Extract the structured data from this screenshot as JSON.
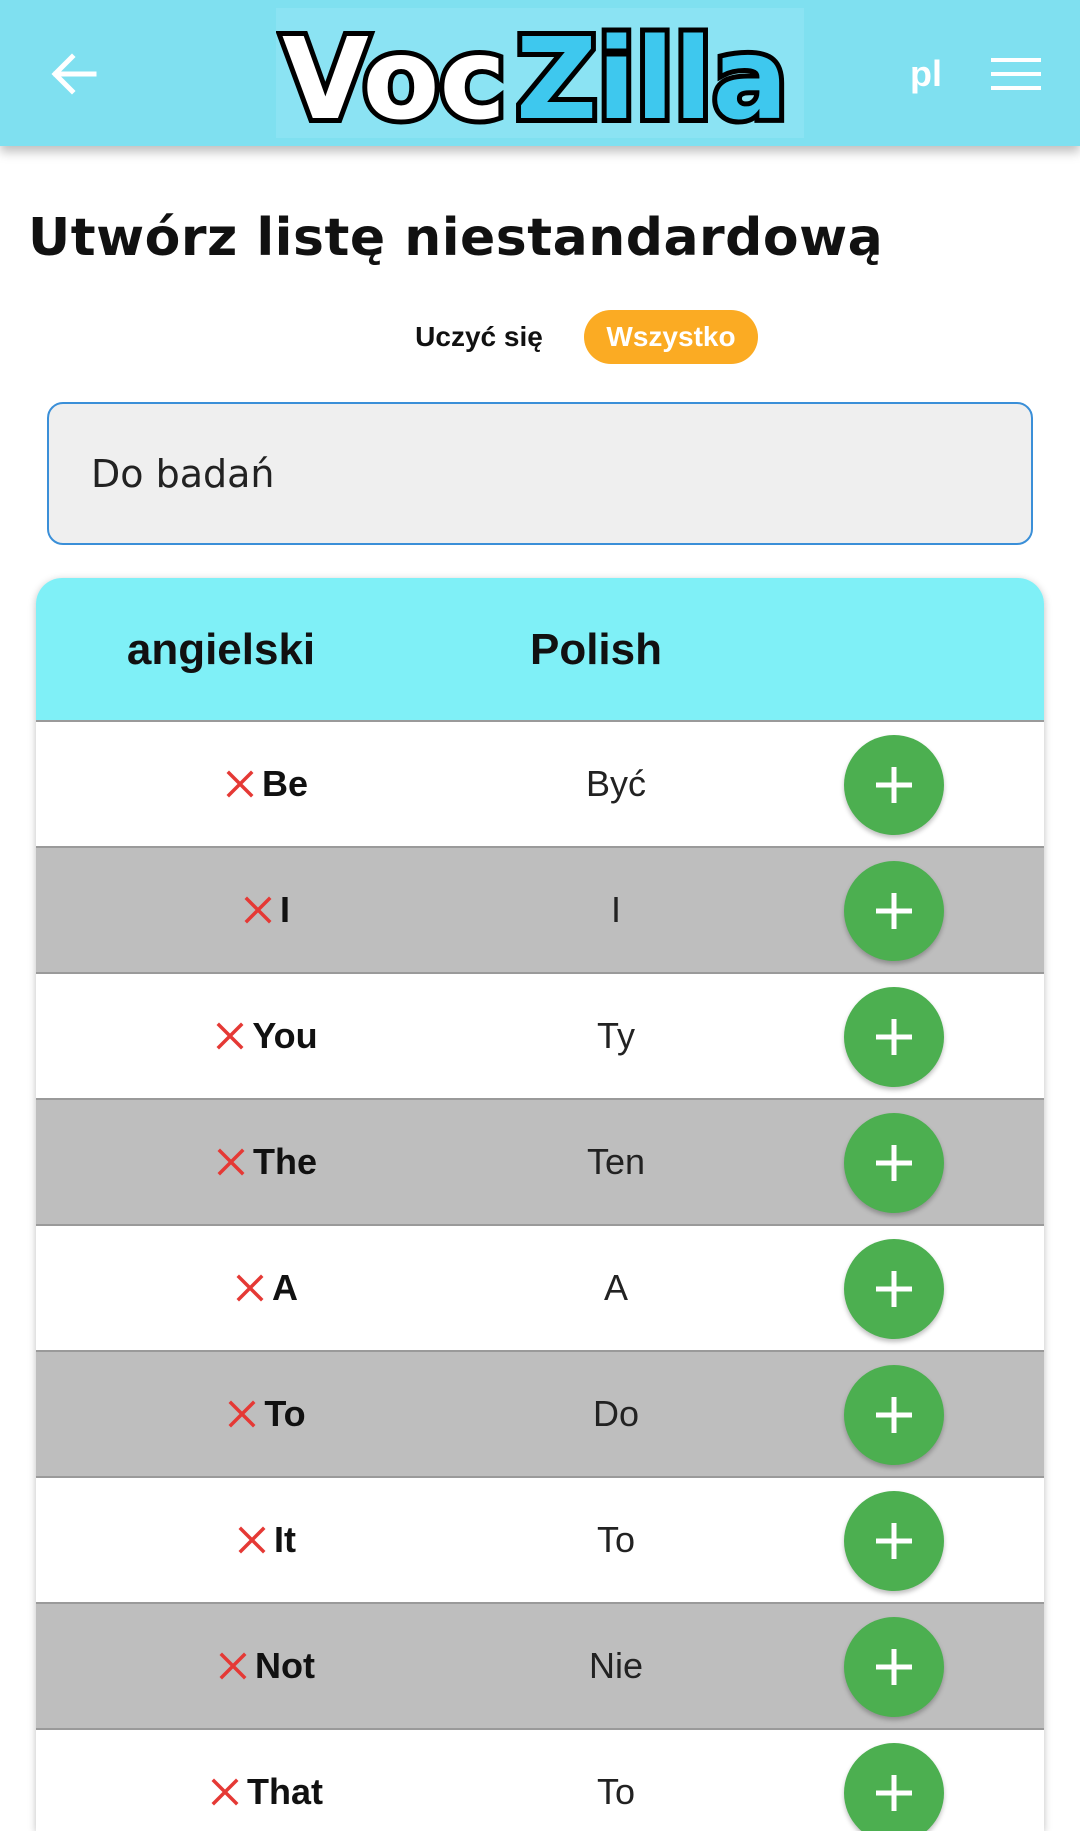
{
  "header": {
    "logo_text_a": "Voc",
    "logo_text_b": "Zilla",
    "language": "pl"
  },
  "page": {
    "title": "Utwórz listę niestandardową"
  },
  "toggle": {
    "learn_label": "Uczyć się",
    "all_label": "Wszystko"
  },
  "list_name": {
    "value": "Do badań"
  },
  "table": {
    "col_source": "angielski",
    "col_target": "Polish",
    "rows": [
      {
        "en": "Be",
        "pl": "Być"
      },
      {
        "en": "I",
        "pl": "I"
      },
      {
        "en": "You",
        "pl": "Ty"
      },
      {
        "en": "The",
        "pl": "Ten"
      },
      {
        "en": "A",
        "pl": "A"
      },
      {
        "en": "To",
        "pl": "Do"
      },
      {
        "en": "It",
        "pl": "To"
      },
      {
        "en": "Not",
        "pl": "Nie"
      },
      {
        "en": "That",
        "pl": "To"
      }
    ]
  },
  "icons": {
    "back": "arrow-left-icon",
    "menu": "hamburger-menu-icon",
    "remove": "close-x-icon",
    "add": "plus-icon"
  },
  "colors": {
    "topbar": "#7fe0f0",
    "table_header": "#7ff0f7",
    "toggle_active": "#fbab23",
    "add_button": "#4caf50",
    "remove_icon": "#e53935",
    "row_alt": "#bebebe",
    "input_border": "#3a8fd8"
  }
}
